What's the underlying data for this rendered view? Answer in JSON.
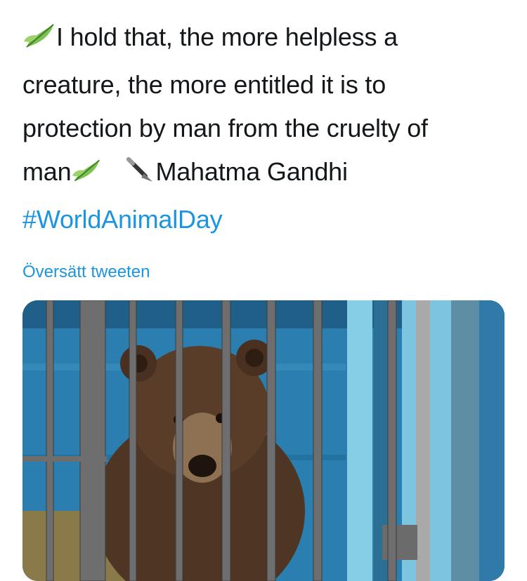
{
  "tweet": {
    "line1": "I hold that, the more helpless a",
    "line2": "creature, the more entitled it is to",
    "line3": "protection by man from the cruelty of",
    "line4_word": "man",
    "line4_author": "Mahatma Gandhi",
    "hashtag": "#WorldAnimalDay",
    "leaf_icon": "herb-emoji",
    "pen_icon": "fountain-pen-emoji"
  },
  "translate_link": "Översätt tweeten",
  "media": {
    "subject": "brown bear behind cage bars",
    "colors": {
      "wall": "#2a7fb0",
      "gate": "#7cc4df",
      "bear": "#5a3d28"
    }
  },
  "colors": {
    "text": "#14171a",
    "link": "#1b95e0",
    "background": "#ffffff"
  }
}
